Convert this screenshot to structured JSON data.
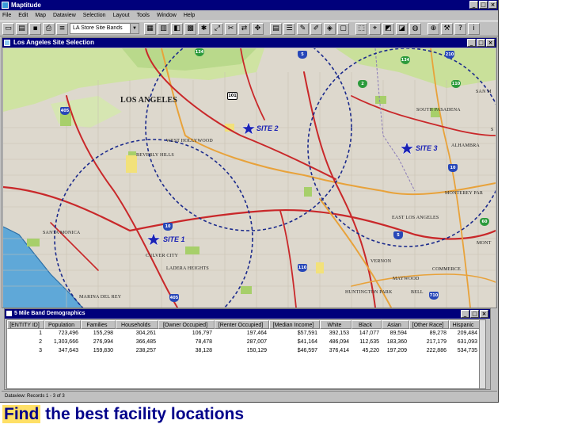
{
  "app": {
    "title": "Maptitude",
    "menu": [
      "File",
      "Edit",
      "Map",
      "Dataview",
      "Selection",
      "Layout",
      "Tools",
      "Window",
      "Help"
    ],
    "layer_select": "LA Store Site Bands"
  },
  "map_window": {
    "title": "Los Angeles Site Selection",
    "cities": [
      {
        "label": "LOS ANGELES"
      },
      {
        "label": "WEST HOLLYWOOD"
      },
      {
        "label": "BEVERLY HILLS"
      },
      {
        "label": "SANTA MONICA"
      },
      {
        "label": "CULVER CITY"
      },
      {
        "label": "LADERA HEIGHTS"
      },
      {
        "label": "MARINA DEL REY"
      },
      {
        "label": "SOUTH PASADENA"
      },
      {
        "label": "ALHAMBRA"
      },
      {
        "label": "MONTEREY PAR"
      },
      {
        "label": "EAST LOS ANGELES"
      },
      {
        "label": "MONT"
      },
      {
        "label": "VERNON"
      },
      {
        "label": "COMMERCE"
      },
      {
        "label": "MAYWOOD"
      },
      {
        "label": "HUNTINGTON PARK"
      },
      {
        "label": "BELL"
      },
      {
        "label": "SAN M"
      },
      {
        "label": "S"
      }
    ],
    "sites": [
      {
        "label": "SITE 1"
      },
      {
        "label": "SITE 2"
      },
      {
        "label": "SITE 3"
      }
    ],
    "shields": [
      "134",
      "5",
      "210",
      "101",
      "134",
      "2",
      "110",
      "405",
      "10",
      "60",
      "5",
      "10",
      "405",
      "110",
      "710"
    ],
    "colors": {
      "band_circle": "#1b2a8c",
      "site_star": "#1a22b5",
      "highway_red": "#c9282a",
      "highway_orange": "#e8a23a",
      "ocean": "#5fa8d8",
      "park_green": "#a7cf6a"
    }
  },
  "dataview": {
    "title": "5 Mile Band Demographics",
    "columns": [
      "[ENTITY ID]",
      "Population",
      "Families",
      "Households",
      "[Owner Occupied]",
      "[Renter Occupied]",
      "[Median Income]",
      "White",
      "Black",
      "Asian",
      "[Other Race]",
      "Hispanic"
    ],
    "rows": [
      [
        "1",
        "723,496",
        "155,298",
        "304,261",
        "106,797",
        "197,464",
        "$57,591",
        "392,153",
        "147,077",
        "89,594",
        "89,278",
        "209,484"
      ],
      [
        "2",
        "1,303,666",
        "276,994",
        "366,485",
        "78,478",
        "287,007",
        "$41,164",
        "486,094",
        "112,635",
        "183,360",
        "217,179",
        "631,093"
      ],
      [
        "3",
        "347,643",
        "159,830",
        "238,257",
        "38,128",
        "150,129",
        "$46,597",
        "376,414",
        "45,220",
        "197,209",
        "222,886",
        "534,735"
      ]
    ]
  },
  "status": {
    "text": "Dataview: Records 1 - 3 of 3"
  },
  "caption": {
    "highlight": "Find",
    "rest": " the best facility locations"
  }
}
